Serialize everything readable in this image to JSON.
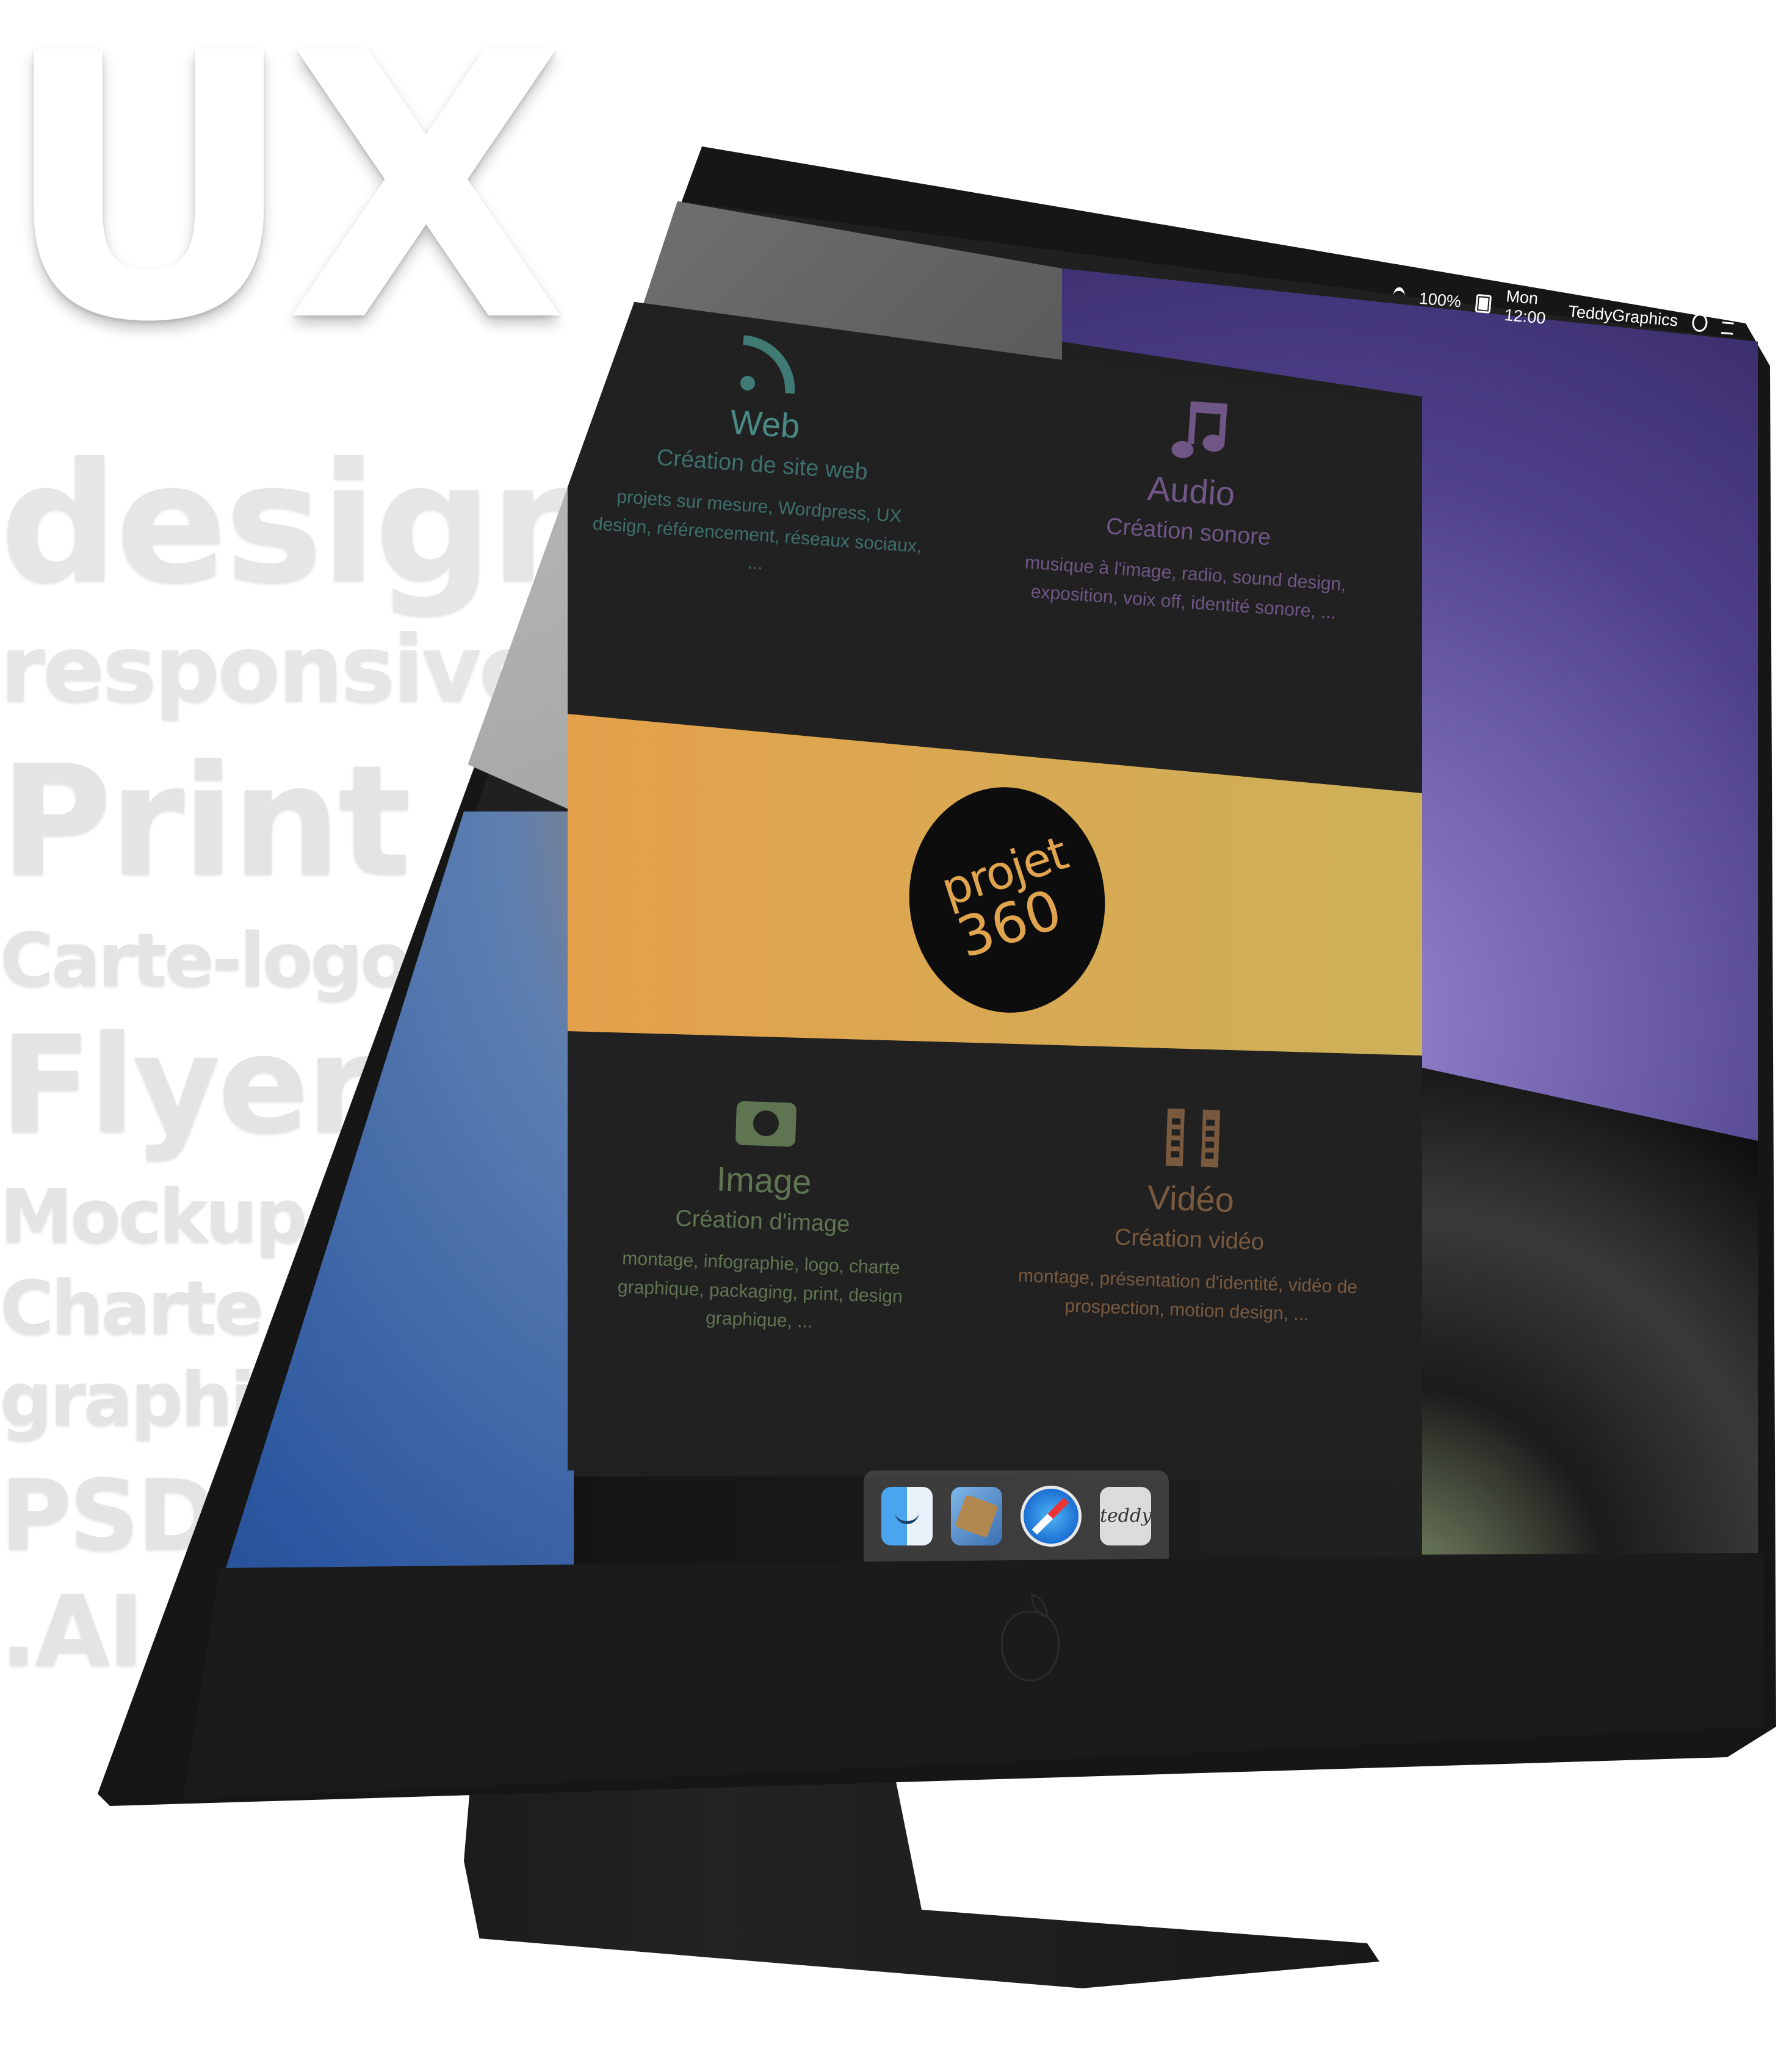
{
  "background_words": [
    "UX",
    "design",
    "responsive",
    "Print",
    "Carte-logo",
    "Flyer",
    "Mockup",
    "Charte",
    "graphi",
    "PSD",
    ".AI"
  ],
  "menubar": {
    "battery": "100%",
    "clock": "Mon 12:00",
    "user": "TeddyGraphics",
    "icons": [
      "wifi-icon",
      "battery-icon",
      "search-icon",
      "list-icon"
    ]
  },
  "services": {
    "web": {
      "icon": "rss-icon",
      "title": "Web",
      "subtitle": "Création de site web",
      "description": "projets sur mesure, Wordpress, UX design, référencement, réseaux sociaux, ...",
      "color": "#3f7a74"
    },
    "audio": {
      "icon": "music-note-icon",
      "title": "Audio",
      "subtitle": "Création sonore",
      "description": "musique à l'image, radio, sound design, exposition, voix off, identité sonore, ...",
      "color": "#6f5686"
    },
    "image": {
      "icon": "camera-icon",
      "title": "Image",
      "subtitle": "Création d'image",
      "description": "montage, infographie, logo, charte graphique, packaging, print, design graphique, ...",
      "color": "#5f7552"
    },
    "video": {
      "icon": "film-icon",
      "title": "Vidéo",
      "subtitle": "Création vidéo",
      "description": "montage, présentation d'identité, vidéo de prospection, motion design, ...",
      "color": "#7a5a3f"
    }
  },
  "logo": {
    "word": "projet",
    "number": "360",
    "band_colors": [
      "#e5a04b",
      "#cdb159"
    ],
    "text_color": "#e0a44e"
  },
  "dock": {
    "apps": [
      "finder-icon",
      "mail-icon",
      "safari-icon",
      "teddy-icon"
    ],
    "teddy_label": "teddy"
  }
}
